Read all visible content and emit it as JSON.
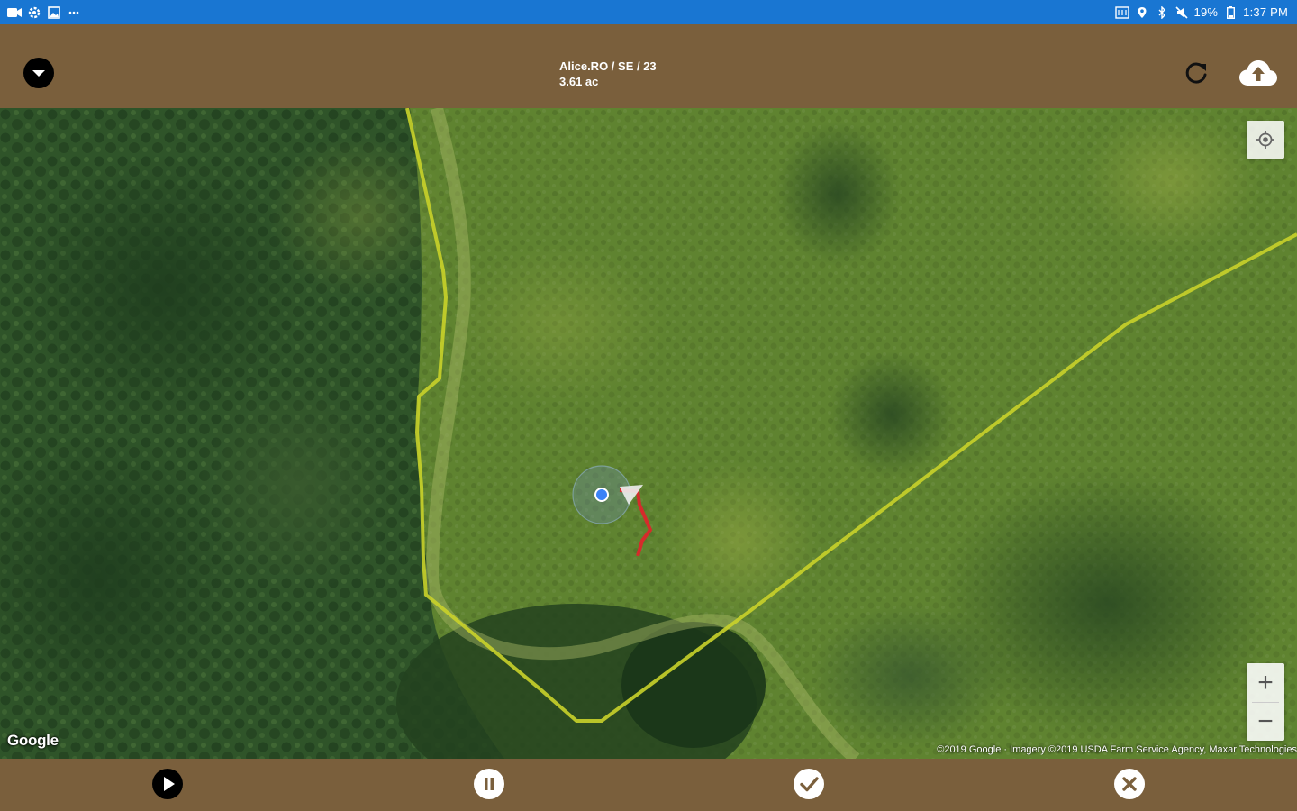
{
  "status_bar": {
    "left_icons": [
      "video-icon",
      "settings-icon",
      "image-icon",
      "more-dots-icon"
    ],
    "right_icons": [
      "nfc-icon",
      "location-icon",
      "bluetooth-icon",
      "mute-icon",
      "battery-icon"
    ],
    "battery": "19%",
    "time": "1:37 PM"
  },
  "header": {
    "title": "Alice.RO / SE / 23",
    "subtitle": "3.61 ac",
    "background": "#7a5f3c"
  },
  "map": {
    "provider_logo": "Google",
    "attribution": "©2019 Google · Imagery ©2019 USDA Farm Service Agency, Maxar Technologies",
    "zoom_in_label": "+",
    "zoom_out_label": "−",
    "boundary_color": "#c9d22a",
    "track_color": "#d62b2b",
    "position_color": "#3b82f6"
  },
  "bottom_bar": {
    "buttons": [
      "play-icon",
      "pause-icon",
      "check-icon",
      "close-icon"
    ]
  }
}
